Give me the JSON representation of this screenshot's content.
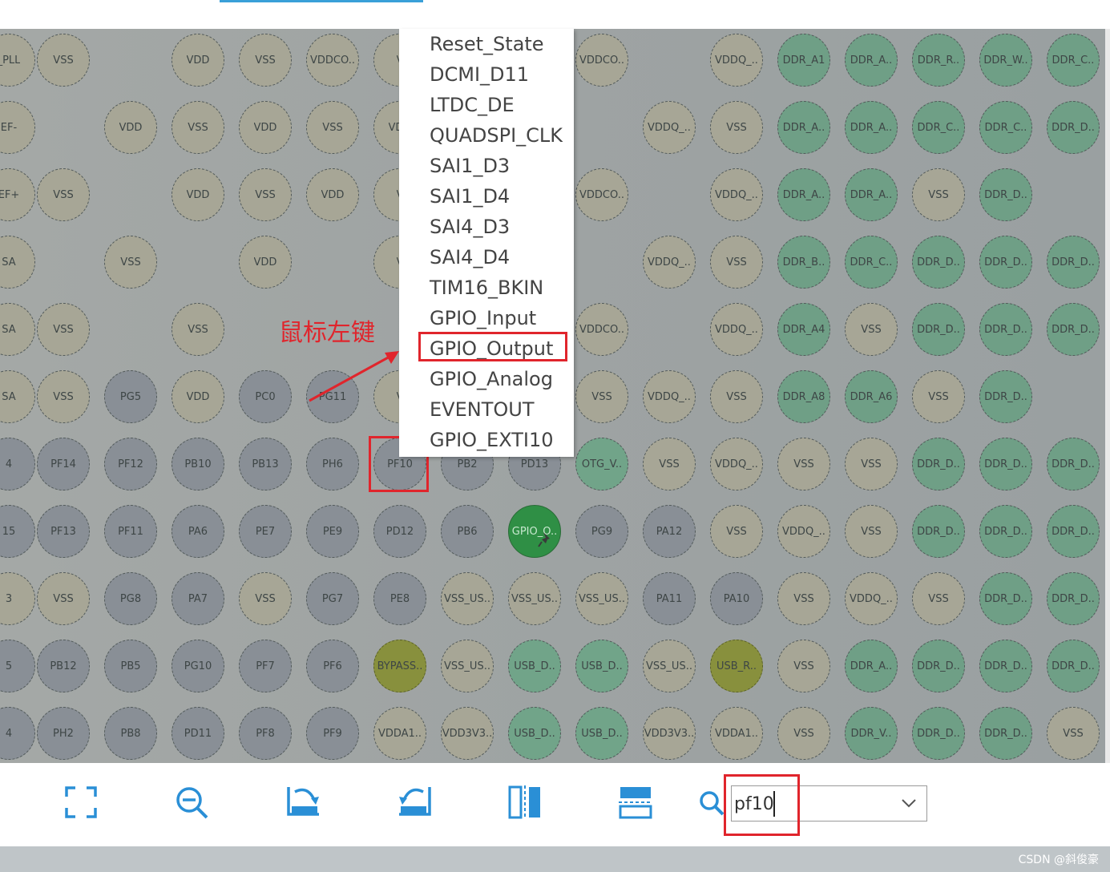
{
  "colors": {
    "power_pin": "#a7a696",
    "io_pin": "#898f96",
    "ddr_pin": "#6f9f86",
    "bypass_pin": "#88903d",
    "active_pin": "#2f8f45",
    "highlight": "#e0252c",
    "accent": "#3aa0d8"
  },
  "pin_rows": [
    [
      {
        "label": "_PLL",
        "type": "power"
      },
      {
        "label": "VSS",
        "type": "power"
      },
      null,
      {
        "label": "VDD",
        "type": "power"
      },
      {
        "label": "VSS",
        "type": "power"
      },
      {
        "label": "VDDCO..",
        "type": "power"
      },
      {
        "label": "V",
        "type": "power"
      },
      null,
      null,
      {
        "label": "VDDCO..",
        "type": "power"
      },
      null,
      {
        "label": "VDDQ_..",
        "type": "power"
      },
      {
        "label": "DDR_A1",
        "type": "ddr"
      },
      {
        "label": "DDR_A..",
        "type": "ddr"
      },
      {
        "label": "DDR_R..",
        "type": "ddr"
      },
      {
        "label": "DDR_W..",
        "type": "ddr"
      },
      {
        "label": "DDR_C..",
        "type": "ddr"
      }
    ],
    [
      {
        "label": "EF-",
        "type": "power"
      },
      null,
      {
        "label": "VDD",
        "type": "power"
      },
      {
        "label": "VSS",
        "type": "power"
      },
      {
        "label": "VDD",
        "type": "power"
      },
      {
        "label": "VSS",
        "type": "power"
      },
      {
        "label": "VDD",
        "type": "power"
      },
      null,
      null,
      null,
      {
        "label": "VDDQ_..",
        "type": "power"
      },
      {
        "label": "VSS",
        "type": "power"
      },
      {
        "label": "DDR_A..",
        "type": "ddr"
      },
      {
        "label": "DDR_A..",
        "type": "ddr"
      },
      {
        "label": "DDR_C..",
        "type": "ddr"
      },
      {
        "label": "DDR_C..",
        "type": "ddr"
      },
      {
        "label": "DDR_D..",
        "type": "ddr"
      }
    ],
    [
      {
        "label": "EF+",
        "type": "power"
      },
      {
        "label": "VSS",
        "type": "power"
      },
      null,
      {
        "label": "VDD",
        "type": "power"
      },
      {
        "label": "VSS",
        "type": "power"
      },
      {
        "label": "VDD",
        "type": "power"
      },
      {
        "label": "V",
        "type": "power"
      },
      null,
      null,
      {
        "label": "VDDCO..",
        "type": "power"
      },
      null,
      {
        "label": "VDDQ_..",
        "type": "power"
      },
      {
        "label": "DDR_A..",
        "type": "ddr"
      },
      {
        "label": "DDR_A..",
        "type": "ddr"
      },
      {
        "label": "VSS",
        "type": "power"
      },
      {
        "label": "DDR_D..",
        "type": "ddr"
      },
      null
    ],
    [
      {
        "label": "SA",
        "type": "power"
      },
      null,
      {
        "label": "VSS",
        "type": "power"
      },
      null,
      {
        "label": "VDD",
        "type": "power"
      },
      null,
      {
        "label": "V",
        "type": "power"
      },
      null,
      null,
      null,
      {
        "label": "VDDQ_..",
        "type": "power"
      },
      {
        "label": "VSS",
        "type": "power"
      },
      {
        "label": "DDR_B..",
        "type": "ddr"
      },
      {
        "label": "DDR_C..",
        "type": "ddr"
      },
      {
        "label": "DDR_D..",
        "type": "ddr"
      },
      {
        "label": "DDR_D..",
        "type": "ddr"
      },
      {
        "label": "DDR_D..",
        "type": "ddr"
      }
    ],
    [
      {
        "label": "SA",
        "type": "power"
      },
      {
        "label": "VSS",
        "type": "power"
      },
      null,
      {
        "label": "VSS",
        "type": "power"
      },
      null,
      null,
      null,
      null,
      null,
      {
        "label": "VDDCO..",
        "type": "power"
      },
      null,
      {
        "label": "VDDQ_..",
        "type": "power"
      },
      {
        "label": "DDR_A4",
        "type": "ddr"
      },
      {
        "label": "VSS",
        "type": "power"
      },
      {
        "label": "DDR_D..",
        "type": "ddr"
      },
      {
        "label": "DDR_D..",
        "type": "ddr"
      },
      {
        "label": "DDR_D..",
        "type": "ddr"
      }
    ],
    [
      {
        "label": "SA",
        "type": "power"
      },
      {
        "label": "VSS",
        "type": "power"
      },
      {
        "label": "PG5",
        "type": "io"
      },
      {
        "label": "VDD",
        "type": "power"
      },
      {
        "label": "PC0",
        "type": "io"
      },
      {
        "label": "PG11",
        "type": "io"
      },
      {
        "label": "V",
        "type": "power"
      },
      null,
      null,
      {
        "label": "VSS",
        "type": "power"
      },
      {
        "label": "VDDQ_..",
        "type": "power"
      },
      {
        "label": "VSS",
        "type": "power"
      },
      {
        "label": "DDR_A8",
        "type": "ddr"
      },
      {
        "label": "DDR_A6",
        "type": "ddr"
      },
      {
        "label": "VSS",
        "type": "power"
      },
      {
        "label": "DDR_D..",
        "type": "ddr"
      },
      null
    ],
    [
      {
        "label": "4",
        "type": "io"
      },
      {
        "label": "PF14",
        "type": "io"
      },
      {
        "label": "PF12",
        "type": "io"
      },
      {
        "label": "PB10",
        "type": "io"
      },
      {
        "label": "PB13",
        "type": "io"
      },
      {
        "label": "PH6",
        "type": "io"
      },
      {
        "label": "PF10",
        "type": "io"
      },
      {
        "label": "PB2",
        "type": "io"
      },
      {
        "label": "PD13",
        "type": "io"
      },
      {
        "label": "OTG_V..",
        "type": "usb"
      },
      {
        "label": "VSS",
        "type": "power"
      },
      {
        "label": "VDDQ_..",
        "type": "power"
      },
      {
        "label": "VSS",
        "type": "power"
      },
      {
        "label": "VSS",
        "type": "power"
      },
      {
        "label": "DDR_D..",
        "type": "ddr"
      },
      {
        "label": "DDR_D..",
        "type": "ddr"
      },
      {
        "label": "DDR_D..",
        "type": "ddr"
      }
    ],
    [
      {
        "label": "15",
        "type": "io"
      },
      {
        "label": "PF13",
        "type": "io"
      },
      {
        "label": "PF11",
        "type": "io"
      },
      {
        "label": "PA6",
        "type": "io"
      },
      {
        "label": "PE7",
        "type": "io"
      },
      {
        "label": "PE9",
        "type": "io"
      },
      {
        "label": "PD12",
        "type": "io"
      },
      {
        "label": "PB6",
        "type": "io"
      },
      {
        "label": "GPIO_O..",
        "type": "active"
      },
      {
        "label": "PG9",
        "type": "io"
      },
      {
        "label": "PA12",
        "type": "io"
      },
      {
        "label": "VSS",
        "type": "power"
      },
      {
        "label": "VDDQ_..",
        "type": "power"
      },
      {
        "label": "VSS",
        "type": "power"
      },
      {
        "label": "DDR_D..",
        "type": "ddr"
      },
      {
        "label": "DDR_D..",
        "type": "ddr"
      },
      {
        "label": "DDR_D..",
        "type": "ddr"
      }
    ],
    [
      {
        "label": "3",
        "type": "power"
      },
      {
        "label": "VSS",
        "type": "power"
      },
      {
        "label": "PG8",
        "type": "io"
      },
      {
        "label": "PA7",
        "type": "io"
      },
      {
        "label": "VSS",
        "type": "power"
      },
      {
        "label": "PG7",
        "type": "io"
      },
      {
        "label": "PE8",
        "type": "io"
      },
      {
        "label": "VSS_US..",
        "type": "power"
      },
      {
        "label": "VSS_US..",
        "type": "power"
      },
      {
        "label": "VSS_US..",
        "type": "power"
      },
      {
        "label": "PA11",
        "type": "io"
      },
      {
        "label": "PA10",
        "type": "io"
      },
      {
        "label": "VSS",
        "type": "power"
      },
      {
        "label": "VDDQ_..",
        "type": "power"
      },
      {
        "label": "VSS",
        "type": "power"
      },
      {
        "label": "DDR_D..",
        "type": "ddr"
      },
      {
        "label": "DDR_D..",
        "type": "ddr"
      }
    ],
    [
      {
        "label": "5",
        "type": "io"
      },
      {
        "label": "PB12",
        "type": "io"
      },
      {
        "label": "PB5",
        "type": "io"
      },
      {
        "label": "PG10",
        "type": "io"
      },
      {
        "label": "PF7",
        "type": "io"
      },
      {
        "label": "PF6",
        "type": "io"
      },
      {
        "label": "BYPASS..",
        "type": "bypass"
      },
      {
        "label": "VSS_US..",
        "type": "power"
      },
      {
        "label": "USB_D..",
        "type": "usb"
      },
      {
        "label": "USB_D..",
        "type": "usb"
      },
      {
        "label": "VSS_US..",
        "type": "power"
      },
      {
        "label": "USB_R..",
        "type": "bypass"
      },
      {
        "label": "VSS",
        "type": "power"
      },
      {
        "label": "DDR_A..",
        "type": "ddr"
      },
      {
        "label": "DDR_D..",
        "type": "ddr"
      },
      {
        "label": "DDR_D..",
        "type": "ddr"
      },
      {
        "label": "DDR_D..",
        "type": "ddr"
      }
    ],
    [
      {
        "label": "4",
        "type": "io"
      },
      {
        "label": "PH2",
        "type": "io"
      },
      {
        "label": "PB8",
        "type": "io"
      },
      {
        "label": "PD11",
        "type": "io"
      },
      {
        "label": "PF8",
        "type": "io"
      },
      {
        "label": "PF9",
        "type": "io"
      },
      {
        "label": "VDDA1..",
        "type": "power"
      },
      {
        "label": "VDD3V3..",
        "type": "power"
      },
      {
        "label": "USB_D..",
        "type": "usb"
      },
      {
        "label": "USB_D..",
        "type": "usb"
      },
      {
        "label": "VDD3V3..",
        "type": "power"
      },
      {
        "label": "VDDA1..",
        "type": "power"
      },
      {
        "label": "VSS",
        "type": "power"
      },
      {
        "label": "DDR_V..",
        "type": "ddr"
      },
      {
        "label": "DDR_D..",
        "type": "ddr"
      },
      {
        "label": "DDR_D..",
        "type": "ddr"
      },
      {
        "label": "VSS",
        "type": "power"
      }
    ]
  ],
  "context_menu": {
    "items": [
      "Reset_State",
      "DCMI_D11",
      "LTDC_DE",
      "QUADSPI_CLK",
      "SAI1_D3",
      "SAI1_D4",
      "SAI4_D3",
      "SAI4_D4",
      "TIM16_BKIN",
      "GPIO_Input",
      "GPIO_Output",
      "GPIO_Analog",
      "EVENTOUT",
      "GPIO_EXTI10"
    ],
    "highlighted_item": "GPIO_Output"
  },
  "annotation": {
    "text": "鼠标左键"
  },
  "toolbar": {
    "buttons": [
      {
        "name": "fit-to-window",
        "icon": "fullscreen-icon"
      },
      {
        "name": "zoom-out",
        "icon": "zoom-out-icon"
      },
      {
        "name": "rotate-clockwise",
        "icon": "rotate-right-icon"
      },
      {
        "name": "rotate-counterclockwise",
        "icon": "rotate-left-icon"
      },
      {
        "name": "flip-vertical",
        "icon": "flip-vertical-icon"
      },
      {
        "name": "flip-horizontal",
        "icon": "flip-horizontal-icon"
      }
    ],
    "search": {
      "icon": "search-icon",
      "value": "pf10"
    }
  },
  "watermark": "CSDN @斜俊豪"
}
